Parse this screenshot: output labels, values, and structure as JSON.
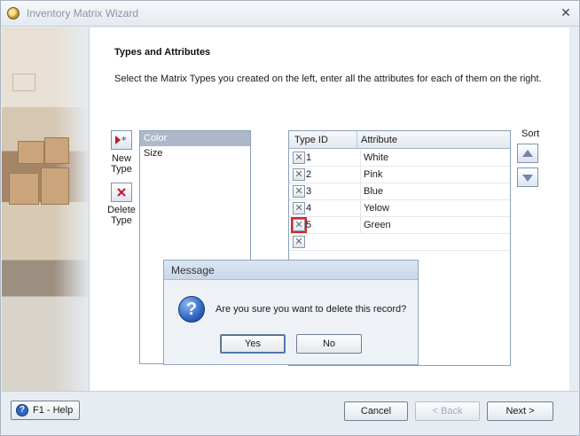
{
  "window": {
    "title": "Inventory Matrix Wizard",
    "close_glyph": "✕"
  },
  "page": {
    "heading": "Types and Attributes",
    "subtitle": "Select the Matrix Types you created on the left, enter all the attributes for each of them on the right."
  },
  "toolbar": {
    "new_type_label_line1": "New",
    "new_type_label_line2": "Type",
    "delete_type_label_line1": "Delete",
    "delete_type_label_line2": "Type"
  },
  "types": {
    "items": [
      "Color",
      "Size"
    ],
    "selected_index": 0
  },
  "attributes_grid": {
    "columns": [
      "Type ID",
      "Attribute"
    ],
    "rows": [
      {
        "id": "1",
        "attribute": "White"
      },
      {
        "id": "2",
        "attribute": "Pink"
      },
      {
        "id": "3",
        "attribute": "Blue"
      },
      {
        "id": "4",
        "attribute": "Yelow"
      },
      {
        "id": "5",
        "attribute": "Green"
      }
    ]
  },
  "sort": {
    "label": "Sort"
  },
  "dialog": {
    "title": "Message",
    "message": "Are you sure you want to delete this record?",
    "yes_label": "Yes",
    "no_label": "No"
  },
  "footer": {
    "help_label": "F1 - Help",
    "help_icon_glyph": "?",
    "cancel_label": "Cancel",
    "back_label": "< Back",
    "next_label": "Next >"
  },
  "colors": {
    "accent": "#3d6fb4",
    "focus_red": "#d8232a",
    "selected_row": "#aeb8ca"
  }
}
